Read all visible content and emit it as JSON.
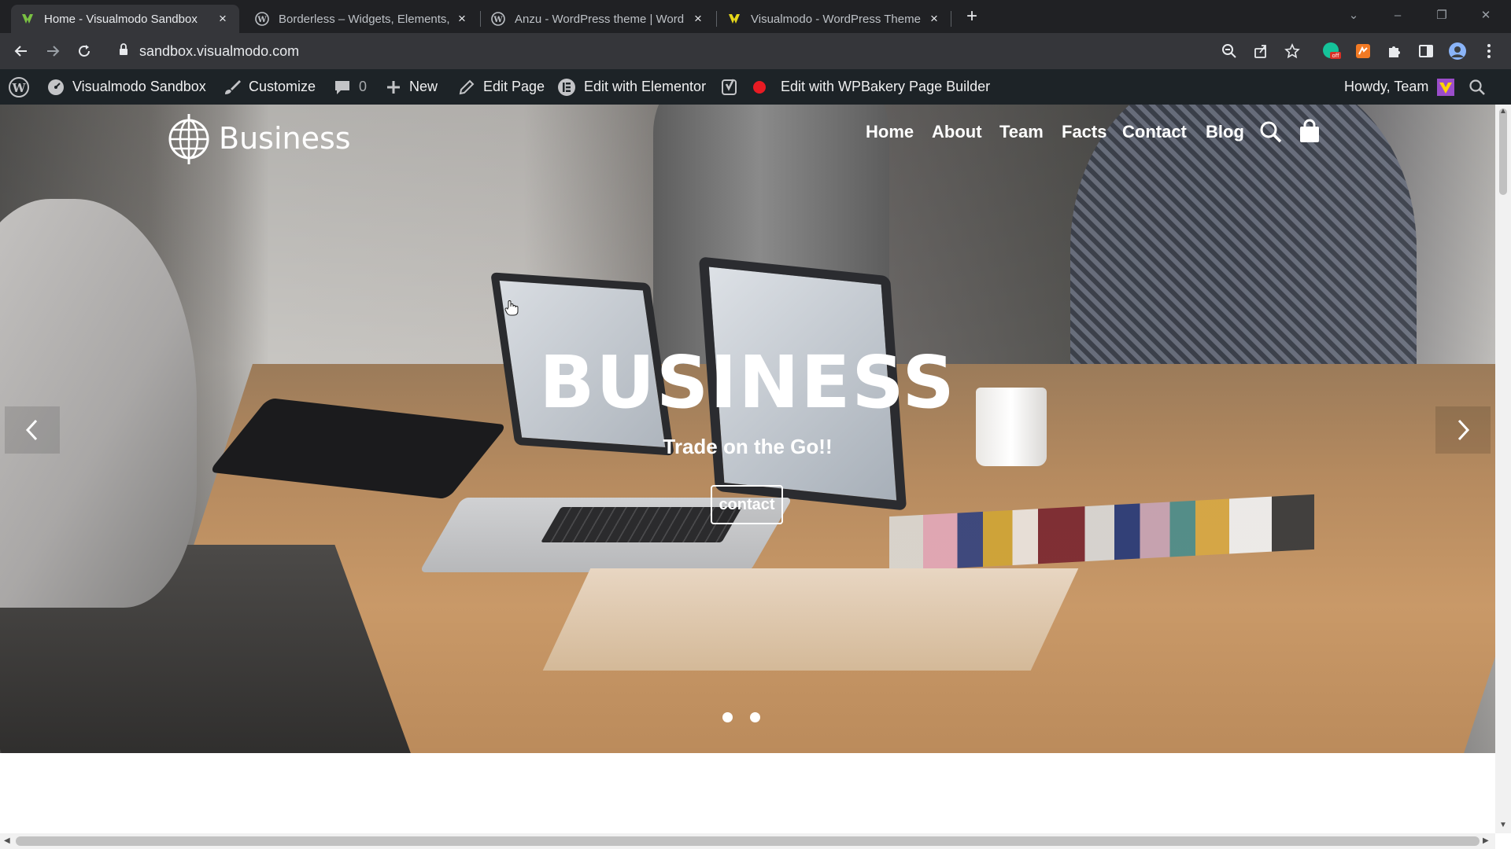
{
  "browser": {
    "tabs": [
      {
        "title": "Home - Visualmodo Sandbox",
        "active": true
      },
      {
        "title": "Borderless – Widgets, Elements,",
        "active": false
      },
      {
        "title": "Anzu - WordPress theme | Word",
        "active": false
      },
      {
        "title": "Visualmodo - WordPress Theme",
        "active": false
      }
    ],
    "new_tab": "+",
    "url": "sandbox.visualmodo.com"
  },
  "adminbar": {
    "site_name": "Visualmodo Sandbox",
    "customize": "Customize",
    "comments_count": "0",
    "new": "New",
    "edit_page": "Edit Page",
    "edit_elementor": "Edit with Elementor",
    "edit_wpbakery": "Edit with WPBakery Page Builder",
    "howdy": "Howdy, Team"
  },
  "site": {
    "logo_text": "Business",
    "nav": [
      "Home",
      "About",
      "Team",
      "Facts",
      "Contact",
      "Blog"
    ]
  },
  "hero": {
    "title": "BUSINESS",
    "subtitle": "Trade on the Go!!",
    "button": "contact",
    "slides": 2
  },
  "colors": {
    "adminbar_bg": "#1d2327",
    "tabstrip_bg": "#202124",
    "toolbar_bg": "#35363a",
    "elementor_red": "#e81b23"
  }
}
